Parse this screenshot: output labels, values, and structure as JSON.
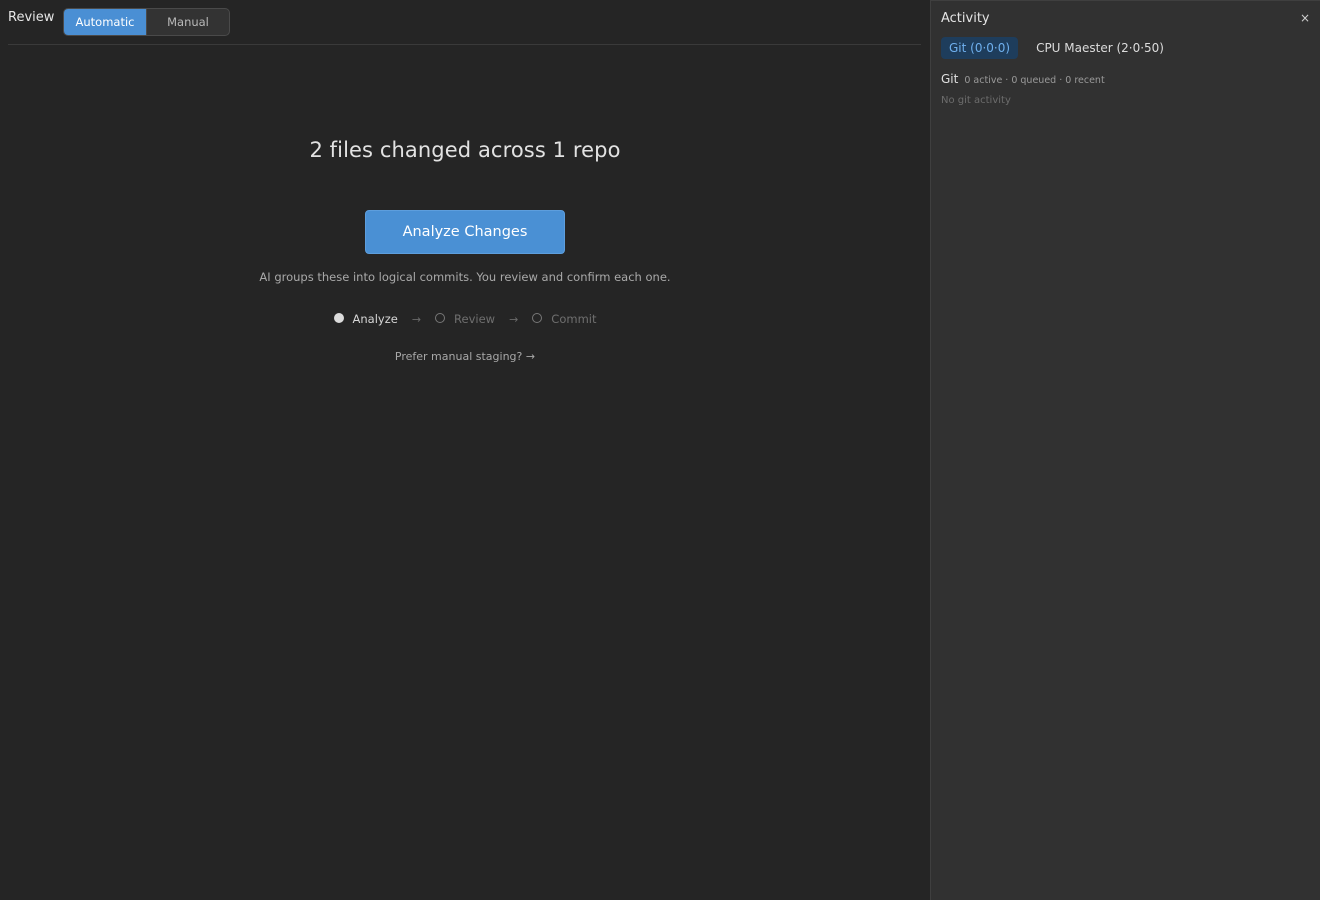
{
  "review": {
    "title": "Review",
    "modes": [
      "Automatic",
      "Manual"
    ],
    "active_mode": "Automatic"
  },
  "summary": {
    "headline": "2 files changed across 1 repo",
    "analyze_label": "Analyze Changes",
    "description": "AI groups these into logical commits. You review and confirm each one.",
    "steps": [
      "Analyze",
      "Review",
      "Commit"
    ],
    "step_arrow": "→",
    "manual_link": "Prefer manual staging? →"
  },
  "activity": {
    "title": "Activity",
    "close_label": "×",
    "tabs": [
      "Git (0·0·0)",
      "CPU Maester (2·0·50)"
    ],
    "git_label": "Git",
    "git_stats": "0 active · 0 queued · 0 recent",
    "empty_message": "No git activity"
  },
  "colors": {
    "accent": "#4a90d4",
    "background": "#252525",
    "panel": "#313131",
    "active_tab_bg": "#1e3d5c",
    "active_tab_text": "#6fb0ee"
  }
}
